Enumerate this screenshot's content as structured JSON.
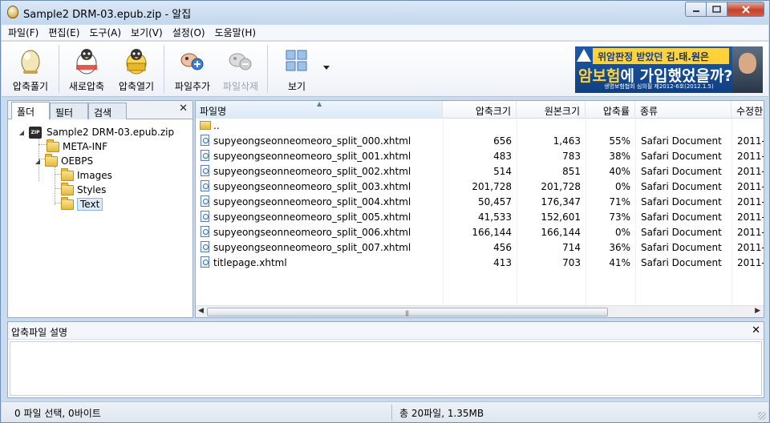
{
  "window": {
    "title": "Sample2 DRM-03.epub.zip - 알집",
    "min_icon": "minimize-icon",
    "max_icon": "maximize-icon",
    "close_icon": "close-icon"
  },
  "menu": [
    "파일(F)",
    "편집(E)",
    "도구(A)",
    "보기(V)",
    "설정(O)",
    "도움말(H)"
  ],
  "toolbar": {
    "extract": "압축풀기",
    "new_archive": "새로압축",
    "open_archive": "압축열기",
    "add_file": "파일추가",
    "delete_file": "파일삭제",
    "view": "보기"
  },
  "banner": {
    "line1_pre": "위암판정 받았던 ",
    "line1_name": "김.태.원은",
    "line2_highlight": "암보험",
    "line2_rest": "에 가입했었을까?",
    "line3": "생명보험협회 심의필 제2012-6호(2012.1.5)"
  },
  "left_pane": {
    "tabs": [
      "폴더",
      "필터",
      "검색"
    ],
    "tree": {
      "root": "Sample2 DRM-03.epub.zip",
      "children": [
        "META-INF",
        "OEBPS"
      ],
      "oebps_children": [
        "Images",
        "Styles",
        "Text"
      ],
      "selected": "Text"
    }
  },
  "file_list": {
    "columns": [
      "파일명",
      "압축크기",
      "원본크기",
      "압축률",
      "종류",
      "수정한"
    ],
    "parent_row": "..",
    "rows": [
      {
        "name": "supyeongseonneomeoro_split_000.xhtml",
        "packed": "656",
        "size": "1,463",
        "ratio": "55%",
        "type": "Safari Document",
        "modified": "2011-"
      },
      {
        "name": "supyeongseonneomeoro_split_001.xhtml",
        "packed": "483",
        "size": "783",
        "ratio": "38%",
        "type": "Safari Document",
        "modified": "2011-"
      },
      {
        "name": "supyeongseonneomeoro_split_002.xhtml",
        "packed": "514",
        "size": "851",
        "ratio": "40%",
        "type": "Safari Document",
        "modified": "2011-"
      },
      {
        "name": "supyeongseonneomeoro_split_003.xhtml",
        "packed": "201,728",
        "size": "201,728",
        "ratio": "0%",
        "type": "Safari Document",
        "modified": "2011-"
      },
      {
        "name": "supyeongseonneomeoro_split_004.xhtml",
        "packed": "50,457",
        "size": "176,347",
        "ratio": "71%",
        "type": "Safari Document",
        "modified": "2011-"
      },
      {
        "name": "supyeongseonneomeoro_split_005.xhtml",
        "packed": "41,533",
        "size": "152,601",
        "ratio": "73%",
        "type": "Safari Document",
        "modified": "2011-"
      },
      {
        "name": "supyeongseonneomeoro_split_006.xhtml",
        "packed": "166,144",
        "size": "166,144",
        "ratio": "0%",
        "type": "Safari Document",
        "modified": "2011-"
      },
      {
        "name": "supyeongseonneomeoro_split_007.xhtml",
        "packed": "456",
        "size": "714",
        "ratio": "36%",
        "type": "Safari Document",
        "modified": "2011-"
      },
      {
        "name": "titlepage.xhtml",
        "packed": "413",
        "size": "703",
        "ratio": "41%",
        "type": "Safari Document",
        "modified": "2011-"
      }
    ]
  },
  "comment": {
    "title": "압축파일 설명"
  },
  "status": {
    "left": "0 파일 선택,  0바이트",
    "right": "총 20파일,  1.35MB"
  }
}
